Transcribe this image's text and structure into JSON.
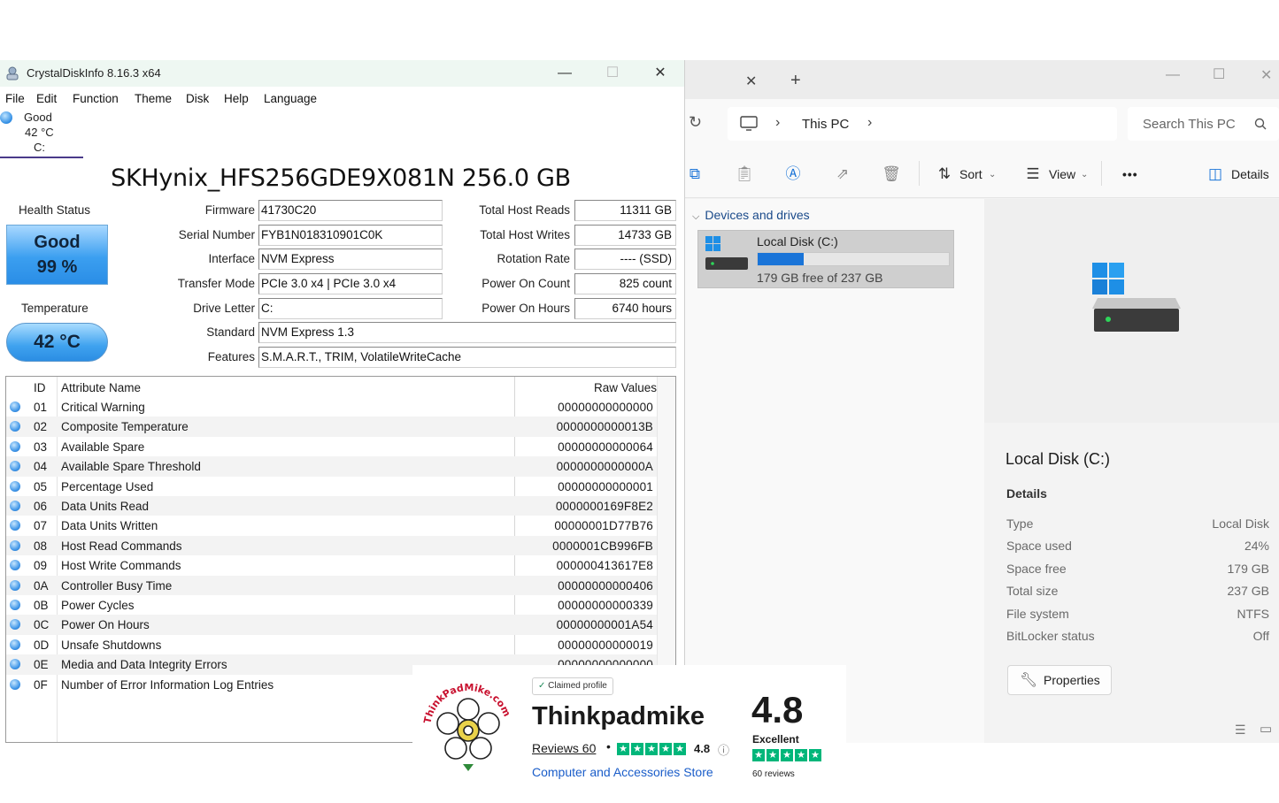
{
  "crystaldiskinfo": {
    "window_title": "CrystalDiskInfo 8.16.3 x64",
    "menu": [
      "File",
      "Edit",
      "Function",
      "Theme",
      "Disk",
      "Help",
      "Language"
    ],
    "disk_tab": {
      "status": "Good",
      "temp": "42 °C",
      "drive": "C:"
    },
    "model": "SKHynix_HFS256GDE9X081N 256.0 GB",
    "health_status_label": "Health Status",
    "health_status": "Good",
    "health_percent": "99 %",
    "temperature_label": "Temperature",
    "temperature": "42 °C",
    "fields": {
      "firmware": {
        "label": "Firmware",
        "value": "41730C20"
      },
      "serial": {
        "label": "Serial Number",
        "value": "FYB1N018310901C0K"
      },
      "interface": {
        "label": "Interface",
        "value": "NVM Express"
      },
      "transfer_mode": {
        "label": "Transfer Mode",
        "value": "PCIe 3.0 x4 | PCIe 3.0 x4"
      },
      "drive_letter": {
        "label": "Drive Letter",
        "value": "C:"
      },
      "standard": {
        "label": "Standard",
        "value": "NVM Express 1.3"
      },
      "features": {
        "label": "Features",
        "value": "S.M.A.R.T., TRIM, VolatileWriteCache"
      },
      "total_host_reads": {
        "label": "Total Host Reads",
        "value": "11311 GB"
      },
      "total_host_writes": {
        "label": "Total Host Writes",
        "value": "14733 GB"
      },
      "rotation_rate": {
        "label": "Rotation Rate",
        "value": "---- (SSD)"
      },
      "power_on_count": {
        "label": "Power On Count",
        "value": "825 count"
      },
      "power_on_hours": {
        "label": "Power On Hours",
        "value": "6740 hours"
      }
    },
    "table_headers": {
      "id": "ID",
      "name": "Attribute Name",
      "raw": "Raw Values"
    },
    "attributes": [
      {
        "id": "01",
        "name": "Critical Warning",
        "raw": "00000000000000"
      },
      {
        "id": "02",
        "name": "Composite Temperature",
        "raw": "0000000000013B"
      },
      {
        "id": "03",
        "name": "Available Spare",
        "raw": "00000000000064"
      },
      {
        "id": "04",
        "name": "Available Spare Threshold",
        "raw": "0000000000000A"
      },
      {
        "id": "05",
        "name": "Percentage Used",
        "raw": "00000000000001"
      },
      {
        "id": "06",
        "name": "Data Units Read",
        "raw": "0000000169F8E2"
      },
      {
        "id": "07",
        "name": "Data Units Written",
        "raw": "00000001D77B76"
      },
      {
        "id": "08",
        "name": "Host Read Commands",
        "raw": "0000001CB996FB"
      },
      {
        "id": "09",
        "name": "Host Write Commands",
        "raw": "000000413617E8"
      },
      {
        "id": "0A",
        "name": "Controller Busy Time",
        "raw": "00000000000406"
      },
      {
        "id": "0B",
        "name": "Power Cycles",
        "raw": "00000000000339"
      },
      {
        "id": "0C",
        "name": "Power On Hours",
        "raw": "00000000001A54"
      },
      {
        "id": "0D",
        "name": "Unsafe Shutdowns",
        "raw": "00000000000019"
      },
      {
        "id": "0E",
        "name": "Media and Data Integrity Errors",
        "raw": "00000000000000"
      },
      {
        "id": "0F",
        "name": "Number of Error Information Log Entries",
        "raw": ""
      }
    ]
  },
  "explorer": {
    "breadcrumb": [
      "This PC"
    ],
    "search_placeholder": "Search This PC",
    "toolbar": {
      "sort": "Sort",
      "view": "View",
      "more": "•••",
      "details": "Details"
    },
    "group_header": "Devices and drives",
    "drive": {
      "name": "Local Disk (C:)",
      "free_text": "179 GB free of 237 GB",
      "used_fraction": 0.24
    },
    "details_pane": {
      "title": "Local Disk (C:)",
      "section": "Details",
      "props": [
        {
          "label": "Type",
          "value": "Local Disk"
        },
        {
          "label": "Space used",
          "value": "24%"
        },
        {
          "label": "Space free",
          "value": "179 GB"
        },
        {
          "label": "Total size",
          "value": "237 GB"
        },
        {
          "label": "File system",
          "value": "NTFS"
        },
        {
          "label": "BitLocker status",
          "value": "Off"
        }
      ],
      "properties_button": "Properties"
    }
  },
  "badge": {
    "logo_text": "ThinkPadMike.com",
    "claimed": "Claimed profile",
    "name": "Thinkpadmike",
    "reviews_link": "Reviews 60",
    "rating_small": "4.8",
    "category": "Computer and Accessories Store",
    "rating_big": "4.8",
    "rating_word": "Excellent",
    "reviews_count": "60 reviews",
    "stars": 5,
    "colors": {
      "star_green": "#00b67a",
      "link_blue": "#1a5dc9"
    }
  },
  "colors": {
    "accent_blue": "#1a74d8",
    "cdi_titlebar": "#eef7f2"
  }
}
